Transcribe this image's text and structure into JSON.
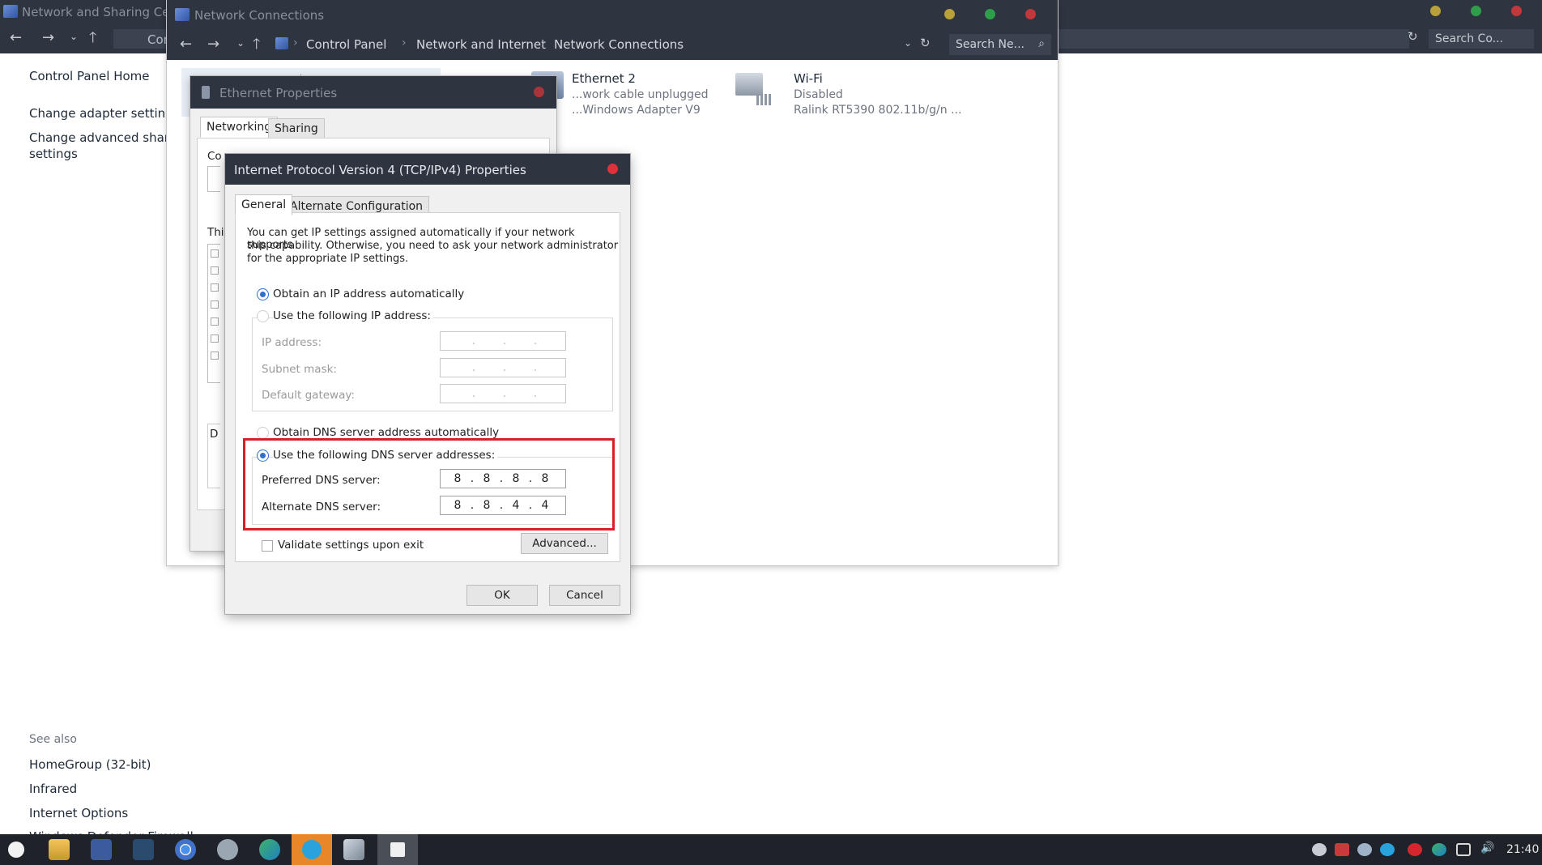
{
  "background_window": {
    "title": "Network and Sharing Cente",
    "breadcrumb": "Con",
    "search": "Search Co...",
    "left_nav": [
      "Control Panel Home",
      "Change adapter settings",
      "Change advanced sharing",
      "settings"
    ],
    "see_also": {
      "heading": "See also",
      "items": [
        "HomeGroup (32-bit)",
        "Infrared",
        "Internet Options",
        "Windows Defender Firewall"
      ]
    },
    "traffic_colors": [
      "#b8a03a",
      "#2e9e4a",
      "#c2373b"
    ]
  },
  "network_connections": {
    "title": "Network Connections",
    "breadcrumbs": [
      "Control Panel",
      "Network and Internet",
      "Network Connections"
    ],
    "search": "Search Ne...",
    "adapters": [
      {
        "name": "Ethernet 2",
        "status": "...work cable unplugged",
        "device": "...Windows Adapter V9"
      },
      {
        "name": "Wi-Fi",
        "status": "Disabled",
        "device": "Ralink RT5390 802.11b/g/n ..."
      }
    ],
    "ethernet_label_fragment": "Ethernet"
  },
  "ethernet_properties": {
    "title": "Ethernet Properties",
    "tabs": [
      "Networking",
      "Sharing"
    ],
    "fragments": [
      "Co",
      "Thi",
      "D"
    ]
  },
  "ipv4_dialog": {
    "title": "Internet Protocol Version 4 (TCP/IPv4) Properties",
    "tabs": [
      "General",
      "Alternate Configuration"
    ],
    "intro": [
      "You can get IP settings assigned automatically if your network supports",
      "this capability. Otherwise, you need to ask your network administrator",
      "for the appropriate IP settings."
    ],
    "obtain_ip_auto": "Obtain an IP address automatically",
    "use_following_ip": "Use the following IP address:",
    "ip_address_label": "IP address:",
    "subnet_mask_label": "Subnet mask:",
    "default_gateway_label": "Default gateway:",
    "obtain_dns_auto": "Obtain DNS server address automatically",
    "use_following_dns": "Use the following DNS server addresses:",
    "preferred_dns_label": "Preferred DNS server:",
    "alternate_dns_label": "Alternate DNS server:",
    "preferred_dns": [
      "8",
      "8",
      "8",
      "8"
    ],
    "alternate_dns": [
      "8",
      "8",
      "4",
      "4"
    ],
    "validate_label": "Validate settings upon exit",
    "advanced_button": "Advanced...",
    "ok_button": "OK",
    "cancel_button": "Cancel",
    "highlight_color": "#d9202a"
  },
  "taskbar": {
    "clock": "21:40",
    "app_icons": [
      "start-icon",
      "file-explorer-icon",
      "facebook-icon",
      "steam-icon",
      "chrome-icon",
      "cat-app-icon",
      "edge-icon",
      "telegram-icon",
      "notes-icon",
      "notepad-icon"
    ]
  }
}
